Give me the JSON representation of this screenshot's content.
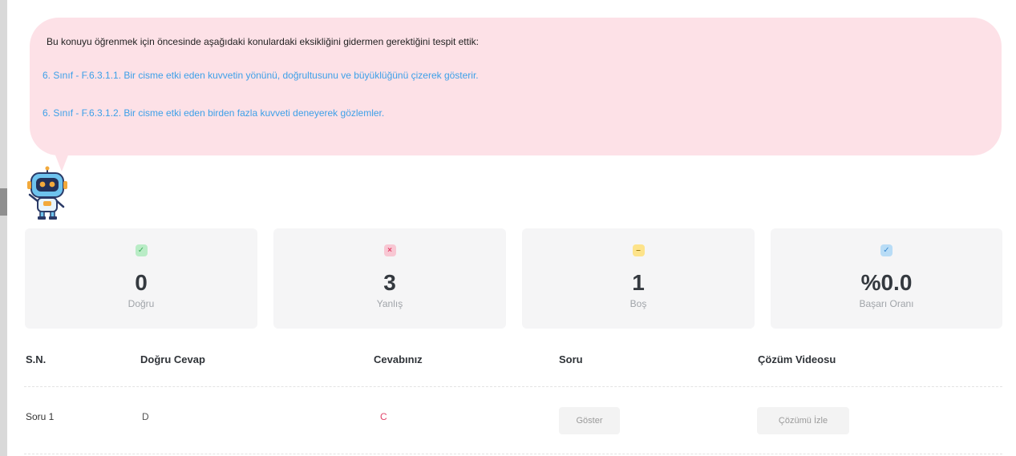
{
  "message": {
    "intro": "Bu konuyu öğrenmek için öncesinde aşağıdaki konulardaki eksikliğini gidermen gerektiğini tespit ettik:",
    "topics": [
      "6. Sınıf - F.6.3.1.1. Bir cisme etki eden kuvvetin yönünü, doğrultusunu ve büyüklüğünü çizerek gösterir.",
      "6. Sınıf - F.6.3.1.2. Bir cisme etki eden birden fazla kuvveti deneyerek gözlemler."
    ]
  },
  "stats": {
    "correct": {
      "value": "0",
      "label": "Doğru",
      "icon": "check-icon"
    },
    "wrong": {
      "value": "3",
      "label": "Yanlış",
      "icon": "x-icon"
    },
    "blank": {
      "value": "1",
      "label": "Boş",
      "icon": "dash-icon"
    },
    "success": {
      "value": "%0.0",
      "label": "Başarı Oranı",
      "icon": "bookmark-icon"
    }
  },
  "table": {
    "headers": {
      "sn": "S.N.",
      "correct_answer": "Doğru Cevap",
      "your_answer": "Cevabınız",
      "question": "Soru",
      "solution_video": "Çözüm Videosu"
    },
    "rows": [
      {
        "sn": "Soru 1",
        "correct_answer": "D",
        "your_answer": "C",
        "question_button": "Göster",
        "video_button": "Çözümü İzle"
      }
    ]
  },
  "colors": {
    "bubble_bg": "#fde1e7",
    "topic_link": "#3da0e8",
    "wrong_answer": "#e2456b",
    "card_bg": "#f5f5f6"
  }
}
